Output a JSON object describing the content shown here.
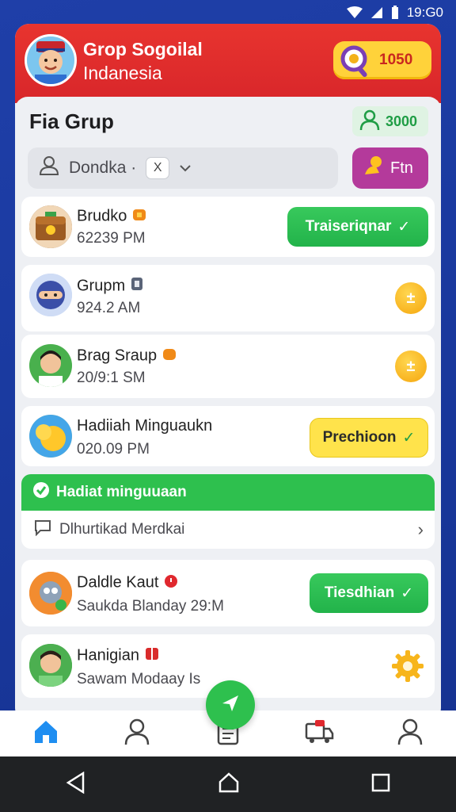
{
  "status_bar": {
    "time": "19:G0"
  },
  "header": {
    "app_title": "Grop Sogoilal",
    "app_subtitle": "Indanesia",
    "coin_value": "1050"
  },
  "group": {
    "title": "Fia Grup",
    "member_count": "3000",
    "search_text": "Dondka ·",
    "search_clear": "X",
    "fin_label": "Ftn"
  },
  "items": [
    {
      "name": "Brudko",
      "time": "62239 PM",
      "action_label": "Traiseriqnar"
    },
    {
      "name": "Grupm",
      "time": "924.2 AM"
    },
    {
      "name": "Brag Sraup",
      "time": "20/9:1 SM"
    },
    {
      "name": "Hadiiah Minguaukn",
      "time": "020.09 PM",
      "action_label": "Prechioon"
    },
    {
      "name": "Daldle Kaut",
      "time": "Saukda  Blanday 29:M",
      "action_label": "Tiesdhian"
    },
    {
      "name": "Hanigian",
      "time": "Sawam Modaay Is"
    }
  ],
  "banner": {
    "title": "Hadiat minguuaan",
    "message": "Dlhurtikad Merdkai"
  },
  "colors": {
    "header_red": "#e8342f",
    "green": "#2ec04e",
    "yellow": "#ffe34b",
    "purple": "#b43a9b",
    "nav_blue": "#1f8ef1"
  }
}
